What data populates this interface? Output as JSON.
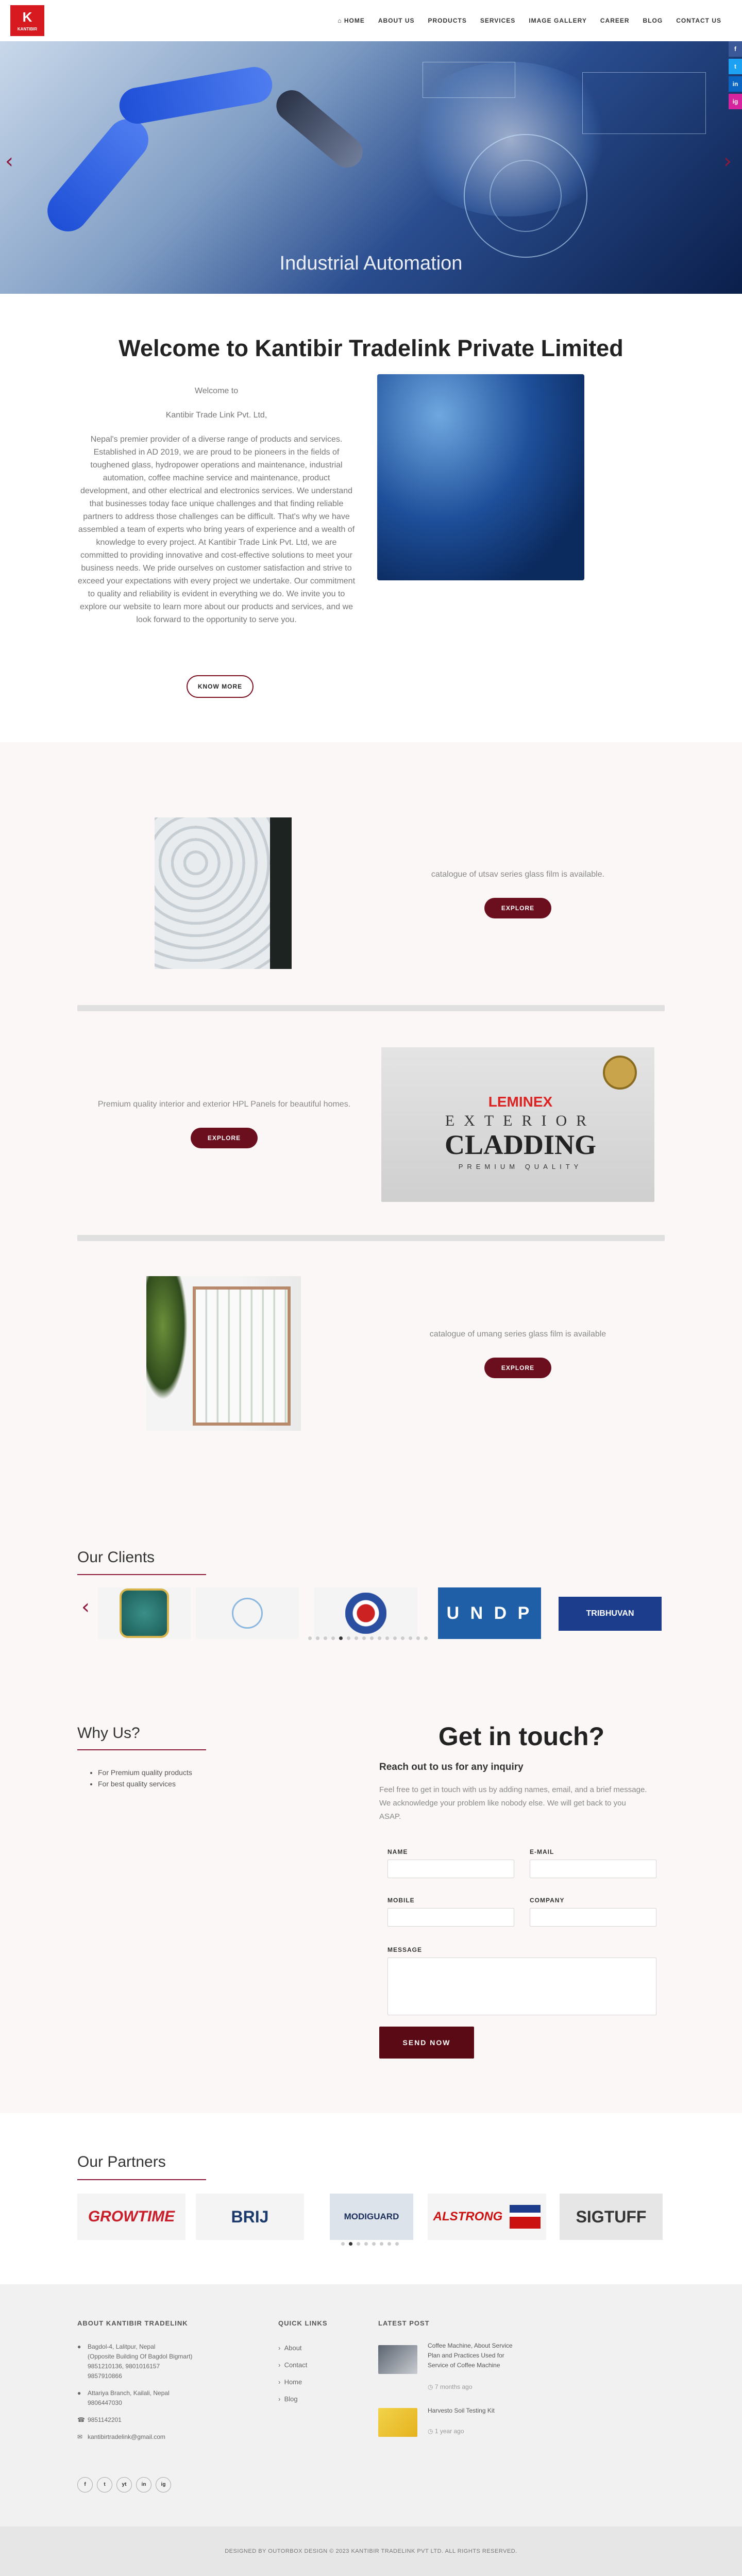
{
  "brand": {
    "logo_letter": "K",
    "logo_text": "KANTIBIR"
  },
  "nav": {
    "home": "HOME",
    "about": "ABOUT US",
    "products": "PRODUCTS",
    "services": "SERVICES",
    "gallery": "IMAGE GALLERY",
    "career": "CAREER",
    "blog": "BLOG",
    "contact": "CONTACT US"
  },
  "hero": {
    "caption": "Industrial Automation"
  },
  "social_side": [
    "f",
    "t",
    "in",
    "ig"
  ],
  "welcome": {
    "title": "Welcome to Kantibir Tradelink Private Limited",
    "line1": "Welcome to",
    "line2": "Kantibir Trade Link Pvt. Ltd,",
    "body": "Nepal's premier provider of a diverse range of products and services. Established in AD 2019, we are proud to be pioneers in the fields of toughened glass, hydropower operations and maintenance, industrial automation, coffee machine service and maintenance, product development, and other electrical and electronics services. We understand that businesses today face unique challenges and that finding reliable partners to address those challenges can be difficult. That's why we have assembled a team of experts who bring years of experience and a wealth of knowledge to every project. At Kantibir Trade Link Pvt. Ltd, we are committed to providing innovative and cost-effective solutions to meet your business needs. We pride ourselves on customer satisfaction and strive to exceed your expectations with every project we undertake. Our commitment to quality and reliability is evident in everything we do. We invite you to explore our website to learn more about our products and services, and we look forward to the opportunity to serve you.",
    "button": "KNOW MORE"
  },
  "products": [
    {
      "text": "catalogue of utsav series glass film is available.",
      "button": "EXPLORE"
    },
    {
      "text": "Premium quality interior and exterior HPL Panels for beautiful homes.",
      "button": "EXPLORE",
      "img_title": "EXTERIOR",
      "img_big": "CLADDING",
      "img_brand": "LEMINEX",
      "img_sub": "PREMIUM QUALITY"
    },
    {
      "text": "catalogue of umang series glass film is available",
      "button": "EXPLORE"
    }
  ],
  "clients": {
    "title": "Our Clients",
    "logos": [
      "emblem",
      "ringed",
      "nepal-gov",
      "UNDP",
      "TRIBHUVAN"
    ],
    "undp": "U N D P",
    "tia": "TRIBHUVAN"
  },
  "why": {
    "title": "Why Us?",
    "items": [
      "For Premium quality products",
      "For best quality services"
    ]
  },
  "contact": {
    "title": "Get in touch?",
    "subtitle": "Reach out to us for any inquiry",
    "desc": "Feel free to get in touch with us by adding names, email, and a brief message. We acknowledge your problem like nobody else. We will get back to you ASAP.",
    "name": "NAME",
    "email": "E-MAIL",
    "mobile": "MOBILE",
    "company": "COMPANY",
    "message": "MESSAGE",
    "button": "SEND NOW"
  },
  "partners": {
    "title": "Our Partners",
    "logos": [
      "GROWTIME",
      "BRIJ",
      "MODIGUARD",
      "ALSTRONG",
      "SIGTUFF"
    ]
  },
  "footer": {
    "about_title": "ABOUT KANTIBIR TRADELINK",
    "addr1": "Bagdol-4, Lalitpur, Nepal",
    "addr2": "(Opposite Building Of Bagdol Bigmart)",
    "phone1": "9851210136, 9801016157",
    "phone2": "9857910866",
    "branch": "Attariya Branch, Kailali, Nepal",
    "branch_phone": "9806447030",
    "phone3": "9851142201",
    "email": "kantibirtradelink@gmail.com",
    "quick_title": "QUICK LINKS",
    "quick": [
      "About",
      "Contact",
      "Home",
      "Blog"
    ],
    "latest_title": "LATEST POST",
    "post1": "Coffee Machine, About Service Plan and Practices Used for Service of Coffee Machine",
    "post1_time": "7 months ago",
    "post2": "Harvesto Soil Testing Kit",
    "post2_time": "1 year ago",
    "social": [
      "f",
      "t",
      "yt",
      "in",
      "ig"
    ]
  },
  "copyright": "DESIGNED BY OUTORBOX DESIGN © 2023 KANTIBIR TRADELINK PVT LTD. ALL RIGHTS RESERVED.",
  "colors": {
    "brand_red": "#d71920",
    "accent_maroon": "#6b0f1f",
    "hero_blue": "#1e4fd6"
  }
}
